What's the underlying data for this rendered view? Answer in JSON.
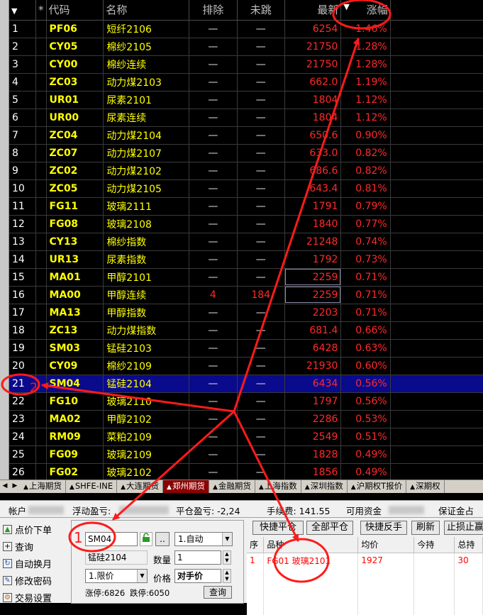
{
  "quote_table": {
    "headers": {
      "sort_arrow": "▼",
      "star": "*",
      "code": "代码",
      "name": "名称",
      "pai": "排除",
      "wei": "未跳",
      "last": "最新",
      "chg_sort": "▼",
      "chg": "涨幅"
    },
    "rows": [
      {
        "idx": "1",
        "code": "PF06",
        "name": "短纤2106",
        "pai": "—",
        "wei": "—",
        "last": "6254",
        "chg": "1.46%"
      },
      {
        "idx": "2",
        "code": "CY05",
        "name": "棉纱2105",
        "pai": "—",
        "wei": "—",
        "last": "21750",
        "chg": "1.28%"
      },
      {
        "idx": "3",
        "code": "CY00",
        "name": "棉纱连续",
        "pai": "—",
        "wei": "—",
        "last": "21750",
        "chg": "1.28%"
      },
      {
        "idx": "4",
        "code": "ZC03",
        "name": "动力煤2103",
        "pai": "—",
        "wei": "—",
        "last": "662.0",
        "chg": "1.19%"
      },
      {
        "idx": "5",
        "code": "UR01",
        "name": "尿素2101",
        "pai": "—",
        "wei": "—",
        "last": "1804",
        "chg": "1.12%"
      },
      {
        "idx": "6",
        "code": "UR00",
        "name": "尿素连续",
        "pai": "—",
        "wei": "—",
        "last": "1804",
        "chg": "1.12%"
      },
      {
        "idx": "7",
        "code": "ZC04",
        "name": "动力煤2104",
        "pai": "—",
        "wei": "—",
        "last": "650.6",
        "chg": "0.90%"
      },
      {
        "idx": "8",
        "code": "ZC07",
        "name": "动力煤2107",
        "pai": "—",
        "wei": "—",
        "last": "633.0",
        "chg": "0.82%"
      },
      {
        "idx": "9",
        "code": "ZC02",
        "name": "动力煤2102",
        "pai": "—",
        "wei": "—",
        "last": "686.6",
        "chg": "0.82%"
      },
      {
        "idx": "10",
        "code": "ZC05",
        "name": "动力煤2105",
        "pai": "—",
        "wei": "—",
        "last": "643.4",
        "chg": "0.81%"
      },
      {
        "idx": "11",
        "code": "FG11",
        "name": "玻璃2111",
        "pai": "—",
        "wei": "—",
        "last": "1791",
        "chg": "0.79%"
      },
      {
        "idx": "12",
        "code": "FG08",
        "name": "玻璃2108",
        "pai": "—",
        "wei": "—",
        "last": "1840",
        "chg": "0.77%"
      },
      {
        "idx": "13",
        "code": "CY13",
        "name": "棉纱指数",
        "pai": "—",
        "wei": "—",
        "last": "21248",
        "chg": "0.74%"
      },
      {
        "idx": "14",
        "code": "UR13",
        "name": "尿素指数",
        "pai": "—",
        "wei": "—",
        "last": "1792",
        "chg": "0.73%"
      },
      {
        "idx": "15",
        "code": "MA01",
        "name": "甲醇2101",
        "pai": "—",
        "wei": "—",
        "last": "2259",
        "chg": "0.71%"
      },
      {
        "idx": "16",
        "code": "MA00",
        "name": "甲醇连续",
        "pai": "4",
        "wei": "184",
        "last": "2259",
        "chg": "0.71%"
      },
      {
        "idx": "17",
        "code": "MA13",
        "name": "甲醇指数",
        "pai": "—",
        "wei": "—",
        "last": "2203",
        "chg": "0.71%"
      },
      {
        "idx": "18",
        "code": "ZC13",
        "name": "动力煤指数",
        "pai": "—",
        "wei": "—",
        "last": "681.4",
        "chg": "0.66%"
      },
      {
        "idx": "19",
        "code": "SM03",
        "name": "锰硅2103",
        "pai": "—",
        "wei": "—",
        "last": "6428",
        "chg": "0.63%"
      },
      {
        "idx": "20",
        "code": "CY09",
        "name": "棉纱2109",
        "pai": "—",
        "wei": "—",
        "last": "21930",
        "chg": "0.60%"
      },
      {
        "idx": "21",
        "code": "SM04",
        "name": "锰硅2104",
        "pai": "—",
        "wei": "—",
        "last": "6434",
        "chg": "0.56%"
      },
      {
        "idx": "22",
        "code": "FG10",
        "name": "玻璃2110",
        "pai": "—",
        "wei": "—",
        "last": "1797",
        "chg": "0.56%"
      },
      {
        "idx": "23",
        "code": "MA02",
        "name": "甲醇2102",
        "pai": "—",
        "wei": "—",
        "last": "2286",
        "chg": "0.53%"
      },
      {
        "idx": "24",
        "code": "RM09",
        "name": "菜粕2109",
        "pai": "—",
        "wei": "—",
        "last": "2549",
        "chg": "0.51%"
      },
      {
        "idx": "25",
        "code": "FG09",
        "name": "玻璃2109",
        "pai": "—",
        "wei": "—",
        "last": "1828",
        "chg": "0.49%"
      },
      {
        "idx": "26",
        "code": "FG02",
        "name": "玻璃2102",
        "pai": "—",
        "wei": "—",
        "last": "1856",
        "chg": "0.49%"
      }
    ]
  },
  "market_tabs": [
    "上海期货",
    "SHFE-INE",
    "大连期货",
    "郑州期货",
    "金融期货",
    "上海指数",
    "深圳指数",
    "沪期权T报价",
    "深期权"
  ],
  "account_bar": {
    "account_label": "帐户",
    "float_pnl_label": "浮动盈亏:",
    "close_pnl_label": "平仓盈亏: -2,24",
    "fee_label": "手续费: 141.55",
    "available_label": "可用资金",
    "margin_label": "保证金占"
  },
  "nav_menu": [
    {
      "label": "点价下单",
      "icon": "chart-icon"
    },
    {
      "label": "查询",
      "icon": "plus-box-icon"
    },
    {
      "label": "自动换月",
      "icon": "refresh-icon"
    },
    {
      "label": "修改密码",
      "icon": "key-icon"
    },
    {
      "label": "交易设置",
      "icon": "gear-icon"
    }
  ],
  "order_form": {
    "code_value": "SM04",
    "dots_label": "..",
    "mode_select": "1.自动",
    "contract_name": "锰硅2104",
    "qty_label": "数量",
    "qty_value": "1",
    "price_type": "1.限价",
    "price_label": "价格",
    "price_value": "对手价",
    "limit_up": "涨停:6826",
    "limit_down": "跌停:6050",
    "query_button": "查询"
  },
  "position_toolbar": {
    "quick_close": "快捷平仓",
    "close_all": "全部平仓",
    "quick_reverse": "快捷反手",
    "refresh": "刷新",
    "stop": "止损止赢"
  },
  "position_table": {
    "headers": [
      "序",
      "品种",
      "均价",
      "今持",
      "总持"
    ],
    "rows": [
      {
        "seq": "1",
        "symbol": "FG01 玻璃2101",
        "avg": "1927",
        "today": "",
        "total": "30"
      }
    ]
  },
  "annotations": {
    "marker1": "1",
    "marker2": "2",
    "color": "#ff1a1a"
  }
}
